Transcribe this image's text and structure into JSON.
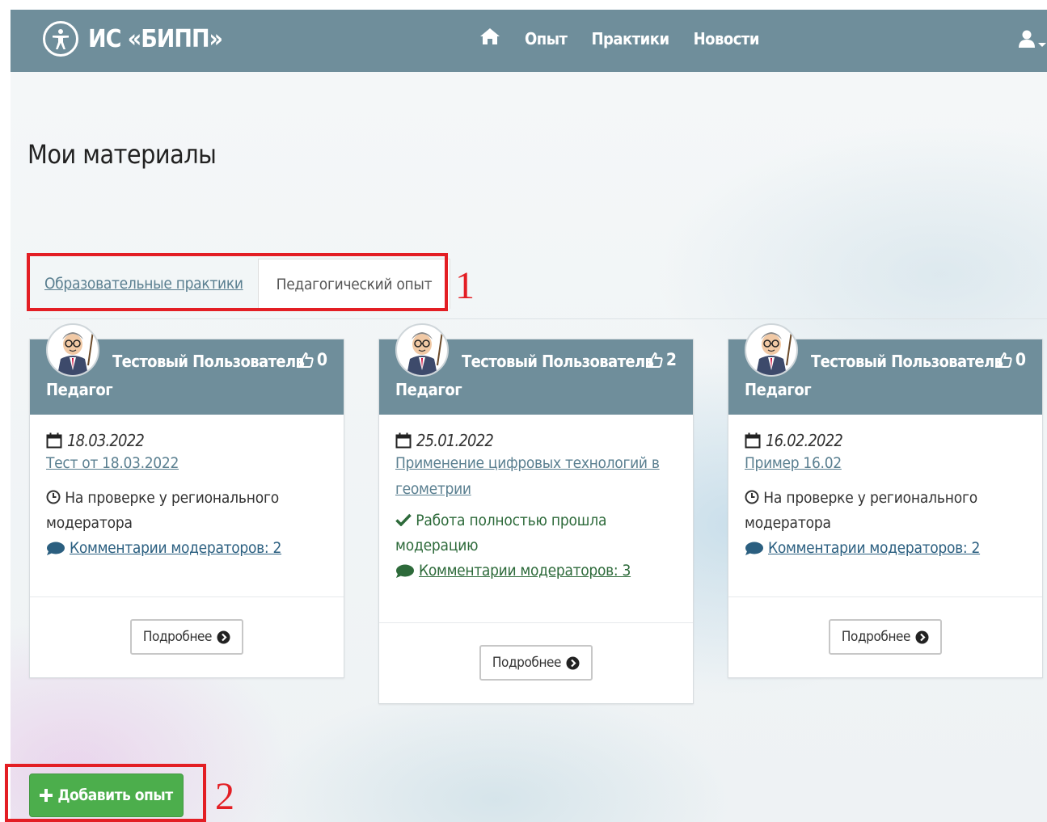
{
  "brand": {
    "title": "ИС «БИПП»",
    "icon": "accessibility-icon"
  },
  "nav": {
    "home_icon": "home-icon",
    "items": [
      "Опыт",
      "Практики",
      "Новости"
    ],
    "user_icon": "user-icon"
  },
  "page": {
    "title": "Мои материалы"
  },
  "tabs": {
    "practices": "Образовательные практики",
    "experience": "Педагогический опыт"
  },
  "annotations": {
    "tabs_marker": "1",
    "add_marker": "2"
  },
  "cards": [
    {
      "author": "Тестовый Пользователь",
      "role": "Педагог",
      "likes": "0",
      "date": "18.03.2022",
      "title": "Тест от 18.03.2022",
      "status": "На проверке у регионального модератора",
      "comments": "Комментарии модераторов: 2",
      "more": "Подробнее"
    },
    {
      "author": "Тестовый Пользователь",
      "role": "Педагог",
      "likes": "2",
      "date": "25.01.2022",
      "title": "Применение цифровых технологий в геометрии",
      "status": "Работа полностью прошла модерацию",
      "comments": "Комментарии модераторов: 3",
      "more": "Подробнее"
    },
    {
      "author": "Тестовый Пользователь",
      "role": "Педагог",
      "likes": "0",
      "date": "16.02.2022",
      "title": "Пример 16.02",
      "status": "На проверке у регионального модератора",
      "comments": "Комментарии модераторов: 2",
      "more": "Подробнее"
    }
  ],
  "actions": {
    "add_label": "Добавить опыт"
  },
  "colors": {
    "header": "#6f8e9b",
    "link": "#5a7f90",
    "success": "#4cae4c",
    "annotation": "#e31e24"
  }
}
